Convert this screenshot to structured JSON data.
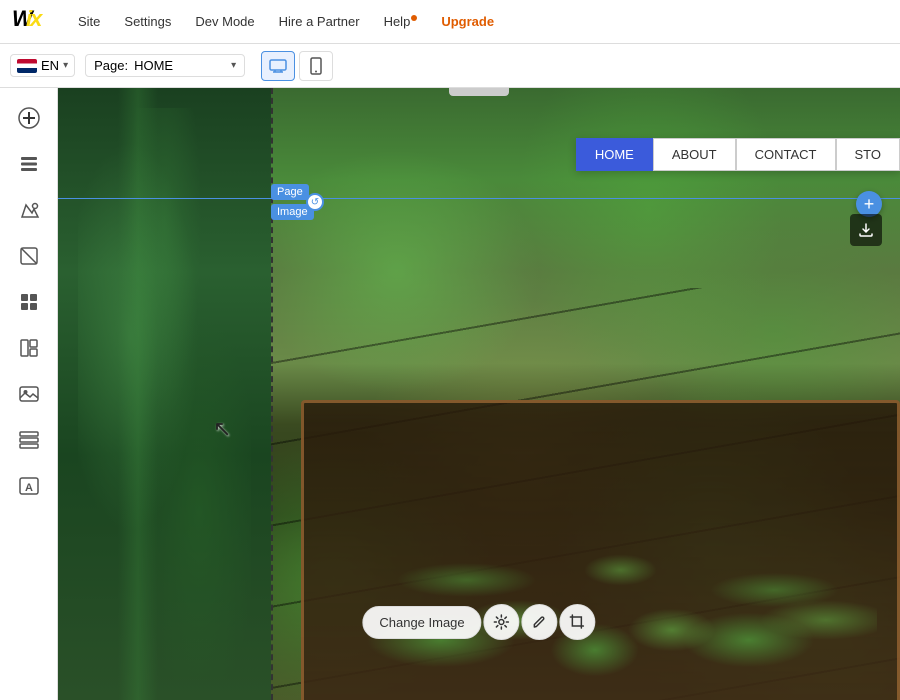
{
  "topbar": {
    "logo": "Wix",
    "menu_items": [
      {
        "label": "Site",
        "id": "site"
      },
      {
        "label": "Settings",
        "id": "settings"
      },
      {
        "label": "Dev Mode",
        "id": "dev-mode"
      },
      {
        "label": "Hire a Partner",
        "id": "hire-partner"
      },
      {
        "label": "Help",
        "id": "help"
      },
      {
        "label": "Upgrade",
        "id": "upgrade"
      }
    ]
  },
  "secondbar": {
    "language": "EN",
    "page_label": "Page:",
    "page_name": "HOME",
    "desktop_tooltip": "Desktop view",
    "mobile_tooltip": "Mobile view"
  },
  "canvas": {
    "nav_items": [
      {
        "label": "HOME",
        "active": true
      },
      {
        "label": "ABOUT",
        "active": false
      },
      {
        "label": "CONTACT",
        "active": false
      },
      {
        "label": "STO",
        "active": false
      }
    ],
    "page_label": "Page",
    "image_label": "Image",
    "change_image_btn": "Change Image",
    "plus_btn": "+",
    "download_icon": "⬇"
  },
  "sidebar": {
    "icons": [
      {
        "id": "add",
        "symbol": "+",
        "label": "Add"
      },
      {
        "id": "pages",
        "symbol": "≡",
        "label": "Pages"
      },
      {
        "id": "design",
        "symbol": "✏",
        "label": "Design"
      },
      {
        "id": "crop",
        "symbol": "◱",
        "label": "Crop"
      },
      {
        "id": "apps",
        "symbol": "⊞",
        "label": "Apps"
      },
      {
        "id": "layout",
        "symbol": "⊟",
        "label": "Layout"
      },
      {
        "id": "media",
        "symbol": "🖼",
        "label": "Media"
      },
      {
        "id": "sections",
        "symbol": "▦",
        "label": "Sections"
      },
      {
        "id": "text",
        "symbol": "A",
        "label": "Text"
      }
    ]
  },
  "colors": {
    "accent_blue": "#4a90e2",
    "nav_active": "#3b5bdb",
    "wix_orange": "#e05c00"
  }
}
